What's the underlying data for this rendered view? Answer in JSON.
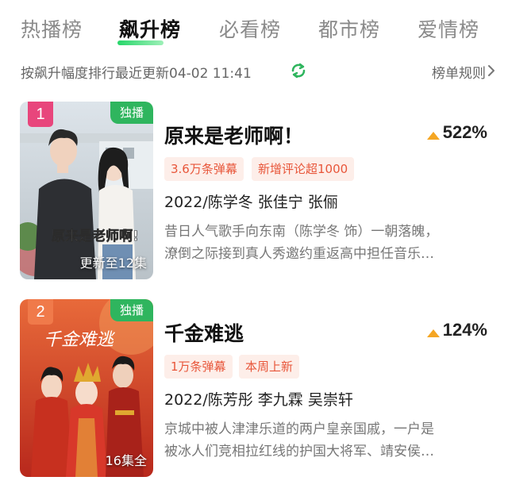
{
  "tabs": [
    {
      "label": "热播榜"
    },
    {
      "label": "飙升榜"
    },
    {
      "label": "必看榜"
    },
    {
      "label": "都市榜"
    },
    {
      "label": "爱情榜"
    }
  ],
  "subbar": {
    "sort_text": "按飙升幅度排行最近更新04-02 11:41",
    "rules_label": "榜单规则"
  },
  "items": [
    {
      "rank": "1",
      "exclusive": "独播",
      "episode_status": "更新至12集",
      "title": "原来是老师啊！",
      "rise": "522%",
      "tags": [
        "3.6万条弹幕",
        "新增评论超1000"
      ],
      "cast": "2022/陈学冬 张佳宁 张俪",
      "desc_line1": "昔日人气歌手向东南（陈学冬 饰）一朝落魄，",
      "desc_line2": "潦倒之际接到真人秀邀约重返高中担任音乐…",
      "poster_logo": "原来是老师啊!"
    },
    {
      "rank": "2",
      "exclusive": "独播",
      "episode_status": "16集全",
      "title": "千金难逃",
      "rise": "124%",
      "tags": [
        "1万条弹幕",
        "本周上新"
      ],
      "cast": "2022/陈芳彤 李九霖 吴崇轩",
      "desc_line1": "京城中被人津津乐道的两户皇亲国戚，一户是",
      "desc_line2": "被冰人们竞相拉红线的护国大将军、靖安侯…",
      "poster_logo": "千金难逃"
    }
  ],
  "colors": {
    "accent_green": "#2fb55e",
    "rank1": "#e8467c",
    "rank2": "#f07a4a",
    "tag_text": "#e8563a",
    "tag_bg": "#fdeee9",
    "rise_triangle": "#f5a623"
  },
  "icons": {
    "refresh": "refresh-icon",
    "chevron": "chevron-right-icon",
    "rise": "triangle-up-icon"
  }
}
